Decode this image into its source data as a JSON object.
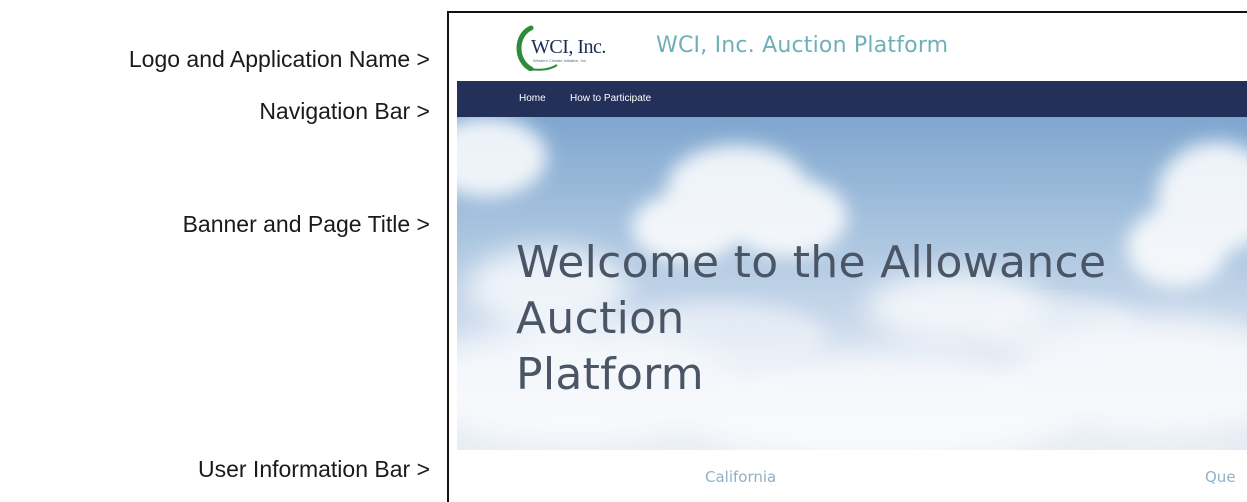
{
  "annotations": {
    "logo": "Logo and Application Name >",
    "nav": "Navigation Bar >",
    "banner": "Banner and Page Title >",
    "user_info": "User Information Bar >"
  },
  "header": {
    "logo_text": "WCI, Inc.",
    "logo_tagline": "Western Climate Initiative, Inc.",
    "app_name": "WCI, Inc. Auction Platform"
  },
  "navbar": {
    "items": [
      {
        "label": "Home"
      },
      {
        "label": "How to Participate"
      }
    ]
  },
  "banner": {
    "title": "Welcome to the Allowance Auction\nPlatform"
  },
  "user_bar": {
    "jurisdictions": [
      {
        "label": "California"
      },
      {
        "label": "Que"
      }
    ]
  },
  "colors": {
    "navbar_bg": "#23305a",
    "app_name": "#6fb0b8",
    "logo_arc": "#2e8b3e",
    "title_text": "#4a5566",
    "jurisdiction_text": "#8fb1c8"
  }
}
